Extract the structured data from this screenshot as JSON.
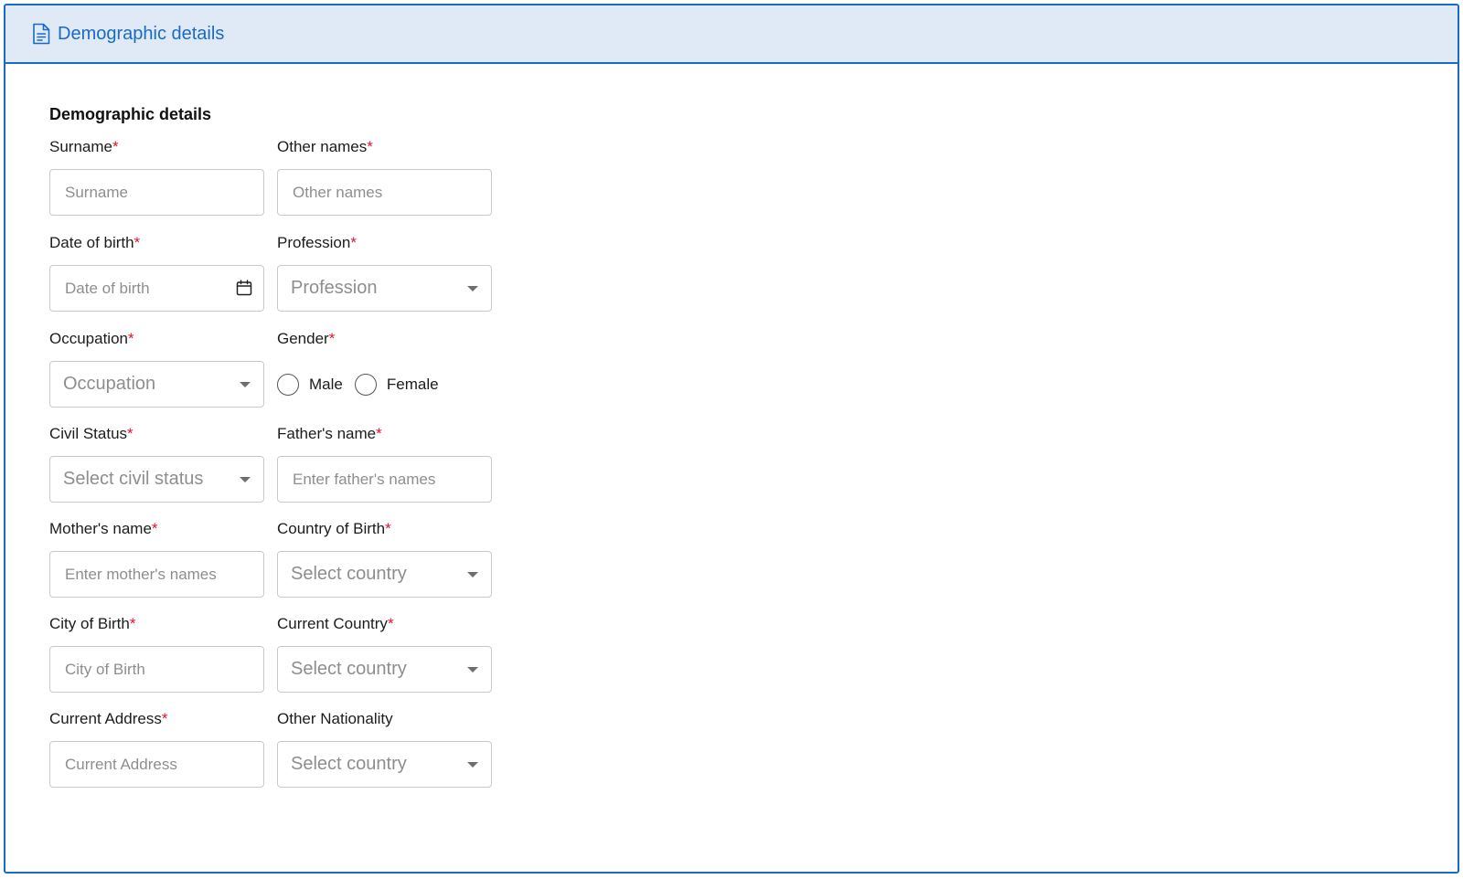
{
  "header": {
    "icon": "document-icon",
    "title": "Demographic details"
  },
  "form": {
    "section_title": "Demographic details",
    "required_marker": "*",
    "fields": {
      "surname": {
        "label": "Surname",
        "placeholder": "Surname",
        "required": true
      },
      "other_names": {
        "label": "Other names",
        "placeholder": "Other names",
        "required": true
      },
      "date_of_birth": {
        "label": "Date of birth",
        "placeholder": "Date of birth",
        "required": true,
        "icon": "calendar-icon"
      },
      "profession": {
        "label": "Profession",
        "value": "Profession",
        "required": true
      },
      "occupation": {
        "label": "Occupation",
        "value": "Occupation",
        "required": true
      },
      "gender": {
        "label": "Gender",
        "required": true,
        "options": [
          "Male",
          "Female"
        ]
      },
      "civil_status": {
        "label": "Civil Status",
        "value": "Select civil status",
        "required": true
      },
      "fathers_name": {
        "label": "Father's name",
        "placeholder": "Enter father's names",
        "required": true
      },
      "mothers_name": {
        "label": "Mother's name",
        "placeholder": "Enter mother's names",
        "required": true
      },
      "country_of_birth": {
        "label": "Country of Birth",
        "value": "Select country",
        "required": true
      },
      "city_of_birth": {
        "label": "City of Birth",
        "placeholder": "City of Birth",
        "required": true
      },
      "current_country": {
        "label": "Current Country",
        "value": "Select country",
        "required": true
      },
      "current_address": {
        "label": "Current Address",
        "placeholder": "Current Address",
        "required": true
      },
      "other_nationality": {
        "label": "Other Nationality",
        "value": "Select country",
        "required": false
      }
    }
  },
  "colors": {
    "accent": "#1a6bc4",
    "header_bg": "#dfeaf6",
    "required": "#e0142a",
    "placeholder": "#8e8e8e"
  }
}
